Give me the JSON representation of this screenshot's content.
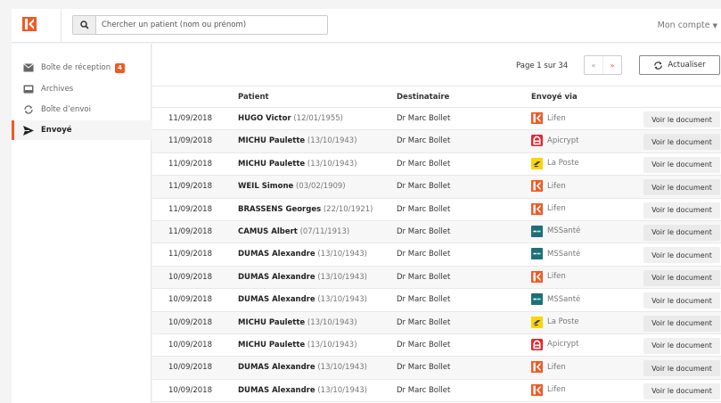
{
  "header": {
    "search_placeholder": "Chercher un patient (nom ou prénom)",
    "account_label": "Mon compte",
    "brand_color": "#f15a24"
  },
  "sidebar": {
    "items": [
      {
        "label": "Boîte de réception",
        "icon": "inbox-icon",
        "badge": "4",
        "active": false
      },
      {
        "label": "Archives",
        "icon": "archive-icon",
        "active": false
      },
      {
        "label": "Boîte d’envoi",
        "icon": "outbox-sync-icon",
        "active": false
      },
      {
        "label": "Envoyé",
        "icon": "send-icon",
        "active": true
      }
    ]
  },
  "toolbar": {
    "page_info": "Page 1 sur 34",
    "prev_label": "«",
    "next_label": "»",
    "refresh_label": "Actualiser"
  },
  "table": {
    "columns": [
      "Patient",
      "Destinataire",
      "Envoyé via"
    ],
    "action_label": "Voir le document",
    "rows": [
      {
        "date": "11/09/2018",
        "name": "HUGO Victor",
        "dob": "(12/01/1955)",
        "dest": "Dr Marc Bollet",
        "via": "Lifen",
        "via_icon": "lifen"
      },
      {
        "date": "11/09/2018",
        "name": "MICHU Paulette",
        "dob": "(13/10/1943)",
        "dest": "Dr Marc Bollet",
        "via": "Apicrypt",
        "via_icon": "apicrypt"
      },
      {
        "date": "11/09/2018",
        "name": "MICHU Paulette",
        "dob": "(13/10/1943)",
        "dest": "Dr Marc Bollet",
        "via": "La Poste",
        "via_icon": "laposte"
      },
      {
        "date": "11/09/2018",
        "name": "WEIL Simone",
        "dob": "(03/02/1909)",
        "dest": "Dr Marc Bollet",
        "via": "Lifen",
        "via_icon": "lifen"
      },
      {
        "date": "11/09/2018",
        "name": "BRASSENS Georges",
        "dob": "(22/10/1921)",
        "dest": "Dr Marc Bollet",
        "via": "Lifen",
        "via_icon": "lifen"
      },
      {
        "date": "11/09/2018",
        "name": "CAMUS Albert",
        "dob": "(07/11/1913)",
        "dest": "Dr Marc Bollet",
        "via": "MSSanté",
        "via_icon": "mssante"
      },
      {
        "date": "11/09/2018",
        "name": "DUMAS Alexandre",
        "dob": "(13/10/1943)",
        "dest": "Dr Marc Bollet",
        "via": "MSSanté",
        "via_icon": "mssante"
      },
      {
        "date": "10/09/2018",
        "name": "DUMAS Alexandre",
        "dob": "(13/10/1943)",
        "dest": "Dr Marc Bollet",
        "via": "Lifen",
        "via_icon": "lifen"
      },
      {
        "date": "10/09/2018",
        "name": "DUMAS Alexandre",
        "dob": "(13/10/1943)",
        "dest": "Dr Marc Bollet",
        "via": "MSSanté",
        "via_icon": "mssante"
      },
      {
        "date": "10/09/2018",
        "name": "MICHU Paulette",
        "dob": "(13/10/1943)",
        "dest": "Dr Marc Bollet",
        "via": "La Poste",
        "via_icon": "laposte"
      },
      {
        "date": "10/09/2018",
        "name": "MICHU Paulette",
        "dob": "(13/10/1943)",
        "dest": "Dr Marc Bollet",
        "via": "Apicrypt",
        "via_icon": "apicrypt"
      },
      {
        "date": "10/09/2018",
        "name": "DUMAS Alexandre",
        "dob": "(13/10/1943)",
        "dest": "Dr Marc Bollet",
        "via": "Lifen",
        "via_icon": "lifen"
      },
      {
        "date": "10/09/2018",
        "name": "DUMAS Alexandre",
        "dob": "(13/10/1943)",
        "dest": "Dr Marc Bollet",
        "via": "Lifen",
        "via_icon": "lifen"
      }
    ]
  }
}
